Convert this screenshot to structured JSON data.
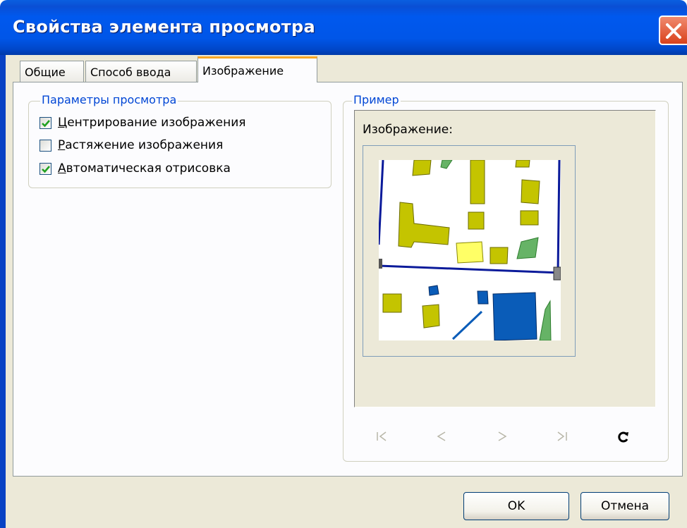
{
  "window": {
    "title": "Свойства элемента просмотра",
    "close_icon": "close-icon"
  },
  "tabs": [
    {
      "label": "Общие",
      "active": false
    },
    {
      "label": "Способ ввода",
      "active": false
    },
    {
      "label": "Изображение",
      "active": true
    }
  ],
  "view_params": {
    "title": "Параметры просмотра",
    "options": [
      {
        "label_first": "Ц",
        "label_rest": "ентрирование изображения",
        "checked": true
      },
      {
        "label_first": "Р",
        "label_rest": "астяжение изображения",
        "checked": false
      },
      {
        "label_first": "А",
        "label_rest": "втоматическая отрисовка",
        "checked": true
      }
    ]
  },
  "example": {
    "title": "Пример",
    "image_label": "Изображение:",
    "nav": [
      "first-icon",
      "prev-icon",
      "next-icon",
      "last-icon",
      "refresh-icon"
    ]
  },
  "buttons": {
    "ok": "OK",
    "cancel": "Отмена"
  },
  "colors": {
    "titlebar": "#0058ee",
    "group_title": "#0046d5",
    "dialog_bg": "#ece9d8",
    "building_olive": "#c4c400",
    "building_yellow": "#ffff66",
    "building_blue": "#0a5cb8",
    "green_area": "#66b366",
    "road": "#0a1a9a"
  }
}
